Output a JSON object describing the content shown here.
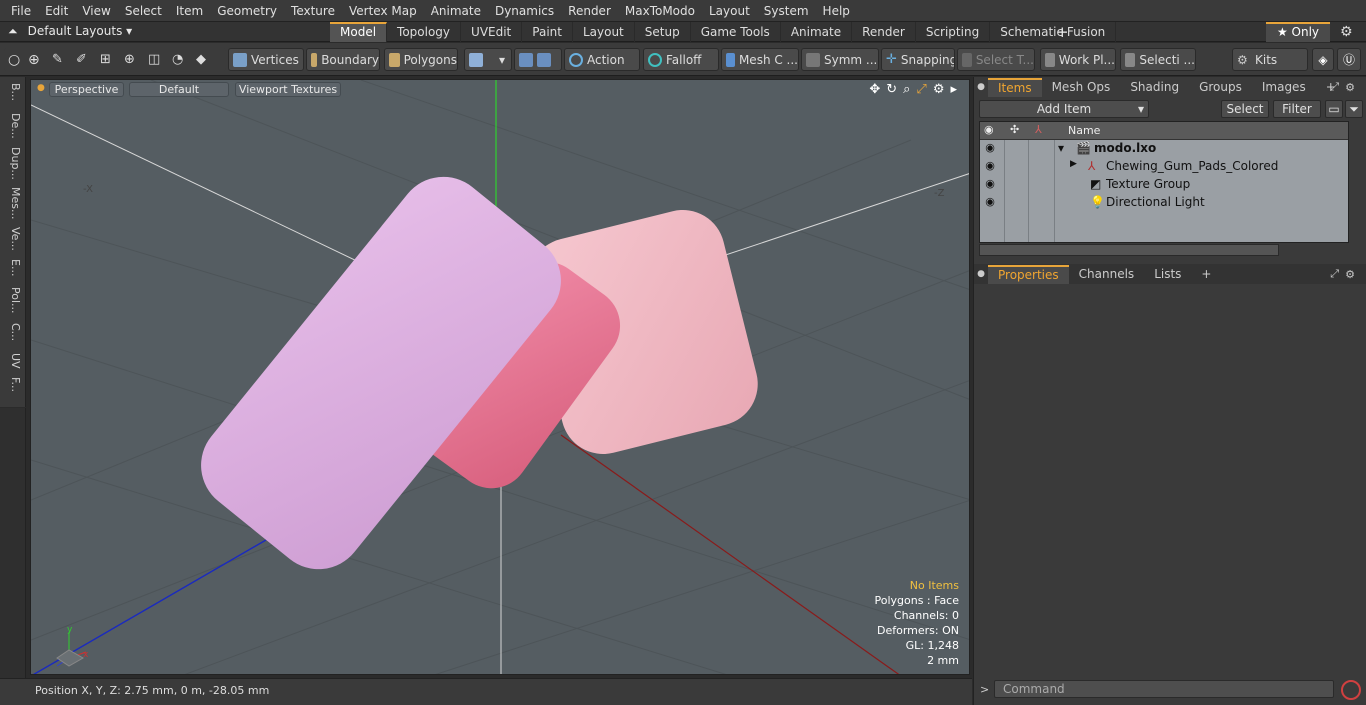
{
  "menu": [
    "File",
    "Edit",
    "View",
    "Select",
    "Item",
    "Geometry",
    "Texture",
    "Vertex Map",
    "Animate",
    "Dynamics",
    "Render",
    "MaxToModo",
    "Layout",
    "System",
    "Help"
  ],
  "layout_selector": "Default Layouts ▾",
  "tabs": [
    "Model",
    "Topology",
    "UVEdit",
    "Paint",
    "Layout",
    "Setup",
    "Game Tools",
    "Animate",
    "Render",
    "Scripting",
    "Schematic Fusion"
  ],
  "active_tab": "Model",
  "only_label": "★  Only",
  "toolbar": {
    "vertices": "Vertices",
    "boundary": "Boundary",
    "polygons": "Polygons",
    "action": "Action",
    "falloff": "Falloff",
    "mesh_c": "Mesh C ...",
    "symm": "Symm ...",
    "snapping": "Snapping",
    "select_t": "Select T...",
    "work_pl": "Work Pl...",
    "selecti": "Selecti ...",
    "kits": "Kits"
  },
  "left_tabs": [
    "B...",
    "De...",
    "Dup...",
    "Mes...",
    "Ve...",
    "E...",
    "Pol...",
    "C...",
    "UV",
    "F..."
  ],
  "viewport": {
    "perspective": "Perspective",
    "default": "Default",
    "textures": "Viewport Textures",
    "axis_labels": {
      "x_neg": "-X",
      "z_neg": "-Z"
    },
    "stats": {
      "no_items": "No Items",
      "polygons": "Polygons : Face",
      "channels": "Channels: 0",
      "deformers": "Deformers: ON",
      "gl": "GL: 1,248",
      "scale": "2 mm"
    }
  },
  "status": "Position X, Y, Z:   2.75 mm, 0 m, -28.05 mm",
  "items_panel": {
    "tabs": [
      "Items",
      "Mesh Ops",
      "Shading",
      "Groups",
      "Images"
    ],
    "add_item": "Add Item",
    "select": "Select",
    "filter": "Filter",
    "name_header": "Name",
    "rows": [
      "modo.lxo",
      "Chewing_Gum_Pads_Colored",
      "Texture Group",
      "Directional Light"
    ]
  },
  "props_panel": {
    "tabs": [
      "Properties",
      "Channels",
      "Lists"
    ]
  },
  "command_placeholder": "Command",
  "colors": {
    "accent": "#e8a53a",
    "gum_lilac": "#dcaede",
    "gum_pink": "#e8809c",
    "gum_light": "#f2bcc6"
  }
}
